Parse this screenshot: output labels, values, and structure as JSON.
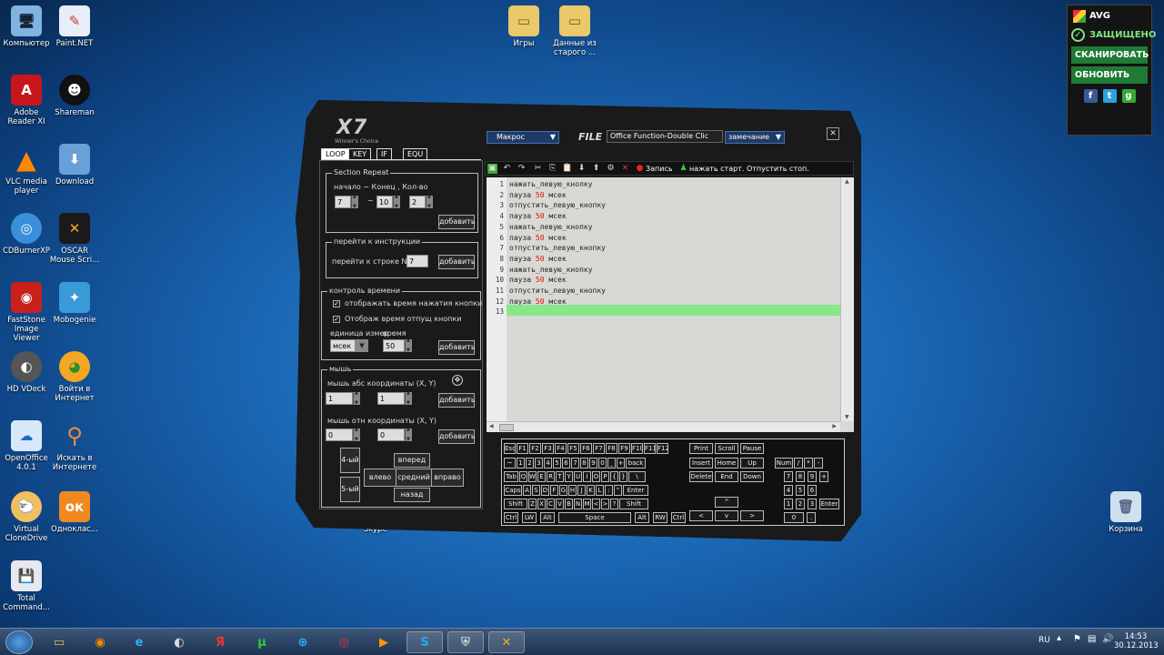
{
  "desktop_icons": [
    {
      "label": "Компьютер",
      "icon": "computer-icon"
    },
    {
      "label": "Paint.NET",
      "icon": "paint-net-icon"
    },
    {
      "label": "Игры",
      "icon": "folder-icon"
    },
    {
      "label": "Данные из старого ...",
      "icon": "folder-icon"
    },
    {
      "label": "Adobe Reader XI",
      "icon": "adobe-reader-icon"
    },
    {
      "label": "Shareman",
      "icon": "shareman-icon"
    },
    {
      "label": "VLC media player",
      "icon": "vlc-icon"
    },
    {
      "label": "Download",
      "icon": "download-icon"
    },
    {
      "label": "CDBurnerXP",
      "icon": "cdburner-icon"
    },
    {
      "label": "OSCAR Mouse Scri...",
      "icon": "oscar-icon"
    },
    {
      "label": "FastStone Image Viewer",
      "icon": "faststone-icon"
    },
    {
      "label": "Mobogenie",
      "icon": "mobogenie-icon"
    },
    {
      "label": "HD VDeck",
      "icon": "hd-vdeck-icon"
    },
    {
      "label": "Войти в Интернет",
      "icon": "internet-icon"
    },
    {
      "label": "OpenOffice 4.0.1",
      "icon": "openoffice-icon"
    },
    {
      "label": "Искать в Интернете",
      "icon": "search-internet-icon"
    },
    {
      "label": "Virtual CloneDrive",
      "icon": "clonedrive-icon"
    },
    {
      "label": "Одноклас...",
      "icon": "odnoklassniki-icon"
    },
    {
      "label": "Total Command...",
      "icon": "total-commander-icon"
    },
    {
      "label": "Корзина",
      "icon": "recycle-bin-icon"
    },
    {
      "label": "Skype",
      "icon": "skype-icon"
    }
  ],
  "avg": {
    "title": "AVG",
    "status": "ЗАЩИЩЕНО",
    "scan": "СКАНИРОВАТЬ",
    "update": "ОБНОВИТЬ",
    "social": [
      "f",
      "t",
      "g"
    ]
  },
  "app": {
    "logo": "X7",
    "logo_sub": "Winner's Choice",
    "macro_dropdown": "Макрос",
    "file_label": "FILE",
    "file_name": "Office Function-Double Clic",
    "note_dropdown": "замечание",
    "close": "✕",
    "tabs": [
      "LOOP",
      "KEY",
      "IF",
      "EQU"
    ],
    "section_repeat": {
      "title": "Section Repeat",
      "caption": "начало ~ Конец , Кол-во",
      "start": "7",
      "tilde": "~",
      "end": "10",
      "count": "2",
      "add": "добавить"
    },
    "goto": {
      "title": "перейти к инструкции",
      "caption": "перейти к строке №:",
      "value": "7",
      "add": "добавить"
    },
    "time": {
      "title": "контроль времени",
      "opt1": "отображать время нажатия кнопки",
      "opt2": "Отображ время отпущ кнопки",
      "unit_label": "единица измер",
      "time_label": "время",
      "unit": "мсек",
      "value": "50",
      "add": "добавить"
    },
    "mouse": {
      "title": "мышь",
      "abs_caption": "мышь абс координаты (X, Y)",
      "abs_x": "1",
      "abs_y": "1",
      "rel_caption": "мышь отн координаты (X, Y)",
      "rel_x": "0",
      "rel_y": "0",
      "add": "добавить",
      "btn4": "4-ый",
      "btn5": "5-ый",
      "up": "вперед",
      "left": "влево",
      "middle": "средний",
      "right": "вправо",
      "down": "назад"
    },
    "toolbar": {
      "record": "Запись",
      "hint": "нажать старт. Отпустить стоп."
    },
    "code_lines": [
      {
        "n": "1",
        "text": "нажать_левую_кнопку",
        "num": "",
        "unit": ""
      },
      {
        "n": "2",
        "text": "пауза ",
        "num": "50",
        "unit": " мсек"
      },
      {
        "n": "3",
        "text": "отпустить_левую_кнопку",
        "num": "",
        "unit": ""
      },
      {
        "n": "4",
        "text": "пауза ",
        "num": "50",
        "unit": " мсек"
      },
      {
        "n": "5",
        "text": "нажать_левую_кнопку",
        "num": "",
        "unit": ""
      },
      {
        "n": "6",
        "text": "пауза ",
        "num": "50",
        "unit": " мсек"
      },
      {
        "n": "7",
        "text": "отпустить_левую_кнопку",
        "num": "",
        "unit": ""
      },
      {
        "n": "8",
        "text": "пауза ",
        "num": "50",
        "unit": " мсек"
      },
      {
        "n": "9",
        "text": "нажать_левую_кнопку",
        "num": "",
        "unit": ""
      },
      {
        "n": "10",
        "text": "пауза ",
        "num": "50",
        "unit": " мсек"
      },
      {
        "n": "11",
        "text": "отпустить_левую_кнопку",
        "num": "",
        "unit": ""
      },
      {
        "n": "12",
        "text": "пауза ",
        "num": "50",
        "unit": " мсек"
      },
      {
        "n": "13",
        "text": "",
        "num": "",
        "unit": ""
      }
    ],
    "keyboard": {
      "row_f": [
        "Esc",
        "F1",
        "F2",
        "F3",
        "F4",
        "F5",
        "F6",
        "F7",
        "F8",
        "F9",
        "F10",
        "F11",
        "F12"
      ],
      "row_1": [
        "~",
        "1",
        "2",
        "3",
        "4",
        "5",
        "6",
        "7",
        "8",
        "9",
        "0",
        "_",
        "+",
        "back"
      ],
      "row_2": [
        "Tab",
        "Q",
        "W",
        "E",
        "R",
        "T",
        "Y",
        "U",
        "I",
        "O",
        "P",
        "{",
        "}",
        "\\"
      ],
      "row_3": [
        "Caps",
        "A",
        "S",
        "D",
        "F",
        "G",
        "H",
        "J",
        "K",
        "L",
        ":",
        "\"",
        "Enter"
      ],
      "row_4": [
        "Shift",
        "Z",
        "X",
        "C",
        "V",
        "B",
        "N",
        "M",
        "<",
        ">",
        "?",
        "Shift"
      ],
      "row_5": [
        "Ctrl",
        "LW",
        "Alt",
        "Space",
        "Alt",
        "RW",
        "Ctrl"
      ],
      "nav_top": [
        "Print",
        "Scroll",
        "Pause"
      ],
      "nav_1": [
        "Insert",
        "Home",
        "Up"
      ],
      "nav_2": [
        "Delete",
        "End",
        "Down"
      ],
      "arrows": [
        "^",
        "<",
        "v",
        ">"
      ],
      "num_1": [
        "Num",
        "/",
        "*",
        "-"
      ],
      "num_2": [
        "7",
        "8",
        "9",
        "+"
      ],
      "num_3": [
        "4",
        "5",
        "6"
      ],
      "num_4": [
        "1",
        "2",
        "3",
        "Enter"
      ],
      "num_5": [
        "0",
        "."
      ]
    }
  },
  "taskbar": {
    "lang": "RU",
    "time": "14:53",
    "date": "30.12.2013"
  }
}
